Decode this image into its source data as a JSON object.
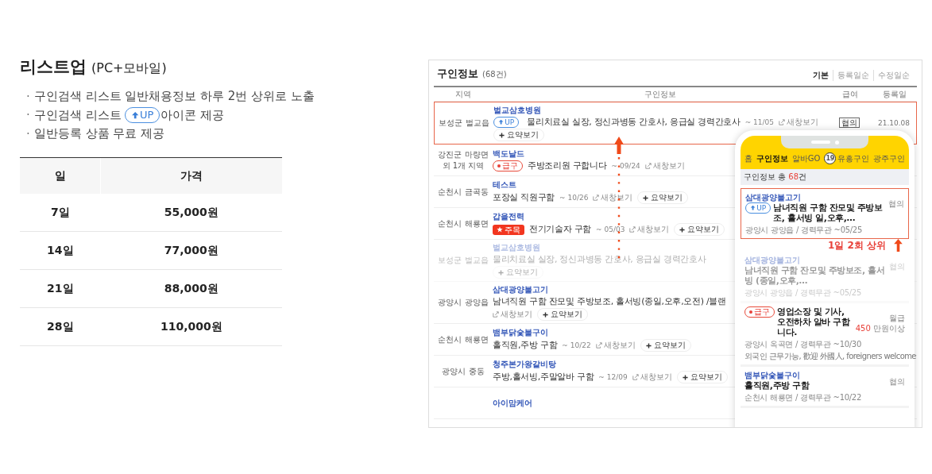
{
  "promo": {
    "title": "리스트업",
    "subtitle": "(PC+모바일)",
    "bullets": [
      {
        "mark": "·",
        "text": "구인검색 리스트 일반채용정보 하루 2번 상위로 노출"
      },
      {
        "mark": "·",
        "text": "구인검색 리스트 ",
        "badge": "UP",
        "after": "아이콘 제공"
      },
      {
        "mark": "·",
        "text": "일반등록 상품 무료 제공"
      }
    ]
  },
  "price_table": {
    "columns": [
      "일",
      "가격"
    ],
    "rows": [
      [
        "7일",
        "55,000원"
      ],
      [
        "14일",
        "77,000원"
      ],
      [
        "21일",
        "88,000원"
      ],
      [
        "28일",
        "110,000원"
      ]
    ]
  },
  "pc_list": {
    "title": "구인정보",
    "count": "(68건)",
    "sorts": [
      {
        "label": "기본",
        "selected": true
      },
      {
        "label": "등록일순",
        "selected": false
      },
      {
        "label": "수정일순",
        "selected": false
      }
    ],
    "columns": [
      "지역",
      "구인정보",
      "급여",
      "등록일"
    ],
    "rows": [
      {
        "region": "보성군 벌교읍",
        "company": "벌교삼호병원",
        "badge": {
          "kind": "up",
          "text": "UP"
        },
        "title": "물리치료실 실장, 정신과병동 간호사, 응급실 경력간호사",
        "line2": [
          {
            "kind": "date",
            "text": "~ 11/05"
          },
          {
            "kind": "link",
            "text": "새창보기"
          }
        ],
        "line3": [
          {
            "kind": "button",
            "text": "요약보기"
          }
        ],
        "pay": "협의",
        "date": "21.10.08",
        "highlighted": true,
        "faded": false
      },
      {
        "region": "강진군 마량면 외 1개 지역",
        "company": "백도날드",
        "badge": {
          "kind": "urgent",
          "text": "급구"
        },
        "title": "주방조리원 구합니다",
        "line2": [
          {
            "kind": "date",
            "text": "~ 09/24"
          },
          {
            "kind": "link",
            "text": "새창보기"
          }
        ],
        "line3": [],
        "highlighted": false,
        "faded": false
      },
      {
        "region": "순천시 금곡동",
        "company": "테스트",
        "title": "포장실 직원구함",
        "line2": [
          {
            "kind": "date",
            "text": "~ 10/26"
          },
          {
            "kind": "link",
            "text": "새창보기"
          },
          {
            "kind": "button",
            "text": "요약보기"
          }
        ],
        "line3": [],
        "highlighted": false,
        "faded": false
      },
      {
        "region": "순천시 해룡면",
        "company": "갑을전력",
        "badge": {
          "kind": "featured",
          "text": "주목"
        },
        "title": "전기기술자 구함",
        "line2": [
          {
            "kind": "date",
            "text": "~ 05/03"
          },
          {
            "kind": "link",
            "text": "새창보기"
          },
          {
            "kind": "button",
            "text": "요약보기"
          }
        ],
        "line3": [],
        "highlighted": false,
        "faded": false
      },
      {
        "region": "보성군 벌교읍",
        "company": "벌교삼호병원",
        "title": "물리치료실 실장, 정신과병동 간호사, 응급실 경력간호사",
        "line2": [],
        "line3": [
          {
            "kind": "button",
            "text": "요약보기"
          }
        ],
        "highlighted": false,
        "faded": true
      },
      {
        "region": "광양시 광양읍",
        "company": "삼대광양불고기",
        "title": "남녀직원 구함 잔모및 주방보조, 홀서빙(종일,오후,오전) /블랜",
        "line2": [],
        "line3": [
          {
            "kind": "link",
            "text": "새창보기"
          },
          {
            "kind": "button",
            "text": "요약보기"
          }
        ],
        "highlighted": false,
        "faded": false
      },
      {
        "region": "순천시 해룡면",
        "company": "뱀부닭숯불구이",
        "title": "홀직원,주방 구함",
        "line2": [
          {
            "kind": "date",
            "text": "~ 10/22"
          },
          {
            "kind": "link",
            "text": "새창보기"
          },
          {
            "kind": "button",
            "text": "요약보기"
          }
        ],
        "line3": [],
        "highlighted": false,
        "faded": false
      },
      {
        "region": "광양시 중동",
        "company": "청주본가왕갈비탕",
        "title": "주방,홀서빙,주말알바 구함",
        "line2": [
          {
            "kind": "date",
            "text": "~ 12/09"
          },
          {
            "kind": "link",
            "text": "새창보기"
          },
          {
            "kind": "button",
            "text": "요약보기"
          }
        ],
        "line3": [],
        "highlighted": false,
        "faded": false
      },
      {
        "company": "아이맘케어",
        "line2": [],
        "line3": [],
        "highlighted": false,
        "faded": false
      }
    ]
  },
  "mobile": {
    "nav": [
      {
        "label": "홈",
        "selected": false
      },
      {
        "label": "구인정보",
        "selected": true
      },
      {
        "label": "알바GO",
        "selected": false
      },
      {
        "label": "유흥구인",
        "badge": "19",
        "selected": false
      },
      {
        "label": "광주구인",
        "selected": false
      }
    ],
    "summary": {
      "prefix": "구인정보 총 ",
      "count": "68",
      "suffix": "건"
    },
    "cards": [
      {
        "company": "삼대광양불고기",
        "badge": {
          "kind": "up",
          "text": "UP"
        },
        "title": "남녀직원 구함 잔모및 주방보조, 홀서빙 일,오후,…",
        "pay_label": "협의",
        "meta": "광양시 광양읍 / 경력무관  ~05/25",
        "highlighted": true,
        "faded": false,
        "callout": "1일 2회 상위"
      },
      {
        "company": "삼대광양불고기",
        "title": "남녀직원 구함 잔모및 주방보조, 홀서빙 (종일,오후,…",
        "pay_label": "협의",
        "meta": "광양시 광양읍 / 경력무관  ~05/25",
        "highlighted": false,
        "faded": true
      },
      {
        "badge": {
          "kind": "urgent",
          "text": "급구"
        },
        "title": "영업소장 및 기사, 오전하차 알바 구합니다.",
        "pay_label": "월급",
        "pay_amount": "450",
        "pay_unit": " 만원이상",
        "meta": "광양시 옥곡면 / 경력무관  ~10/30",
        "note": "외국인 근무가능, 歡迎 外國人, foreigners welcome",
        "highlighted": false,
        "faded": false
      },
      {
        "company": "뱀부닭숯불구이",
        "title": "홀직원,주방 구함",
        "pay_label": "협의",
        "meta": "순천시 해룡면 / 경력무관  ~10/22",
        "highlighted": false,
        "faded": false
      }
    ]
  }
}
